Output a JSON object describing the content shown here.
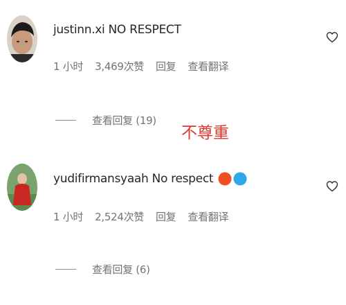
{
  "comments": [
    {
      "username": "justinn.xi",
      "text": "NO RESPECT",
      "emojis": [],
      "time": "1 小时",
      "likes": "3,469次赞",
      "reply_label": "回复",
      "translate_label": "查看翻译",
      "view_replies": "查看回复 (19)",
      "avatar": "avatar-photo-man"
    },
    {
      "username": "yudifirmansyaah",
      "text": "No respect",
      "emojis": [
        {
          "name": "red-circle-icon",
          "color": "#f04e23"
        },
        {
          "name": "blue-circle-icon",
          "color": "#2da8e8"
        }
      ],
      "time": "1 小时",
      "likes": "2,524次赞",
      "reply_label": "回复",
      "translate_label": "查看翻译",
      "view_replies": "查看回复 (6)",
      "avatar": "avatar-photo-red-figure"
    }
  ],
  "annotation": {
    "text": "不尊重",
    "color": "#e0362c"
  },
  "colors": {
    "primary_text": "#262626",
    "secondary_text": "#737373",
    "background": "#ffffff"
  }
}
